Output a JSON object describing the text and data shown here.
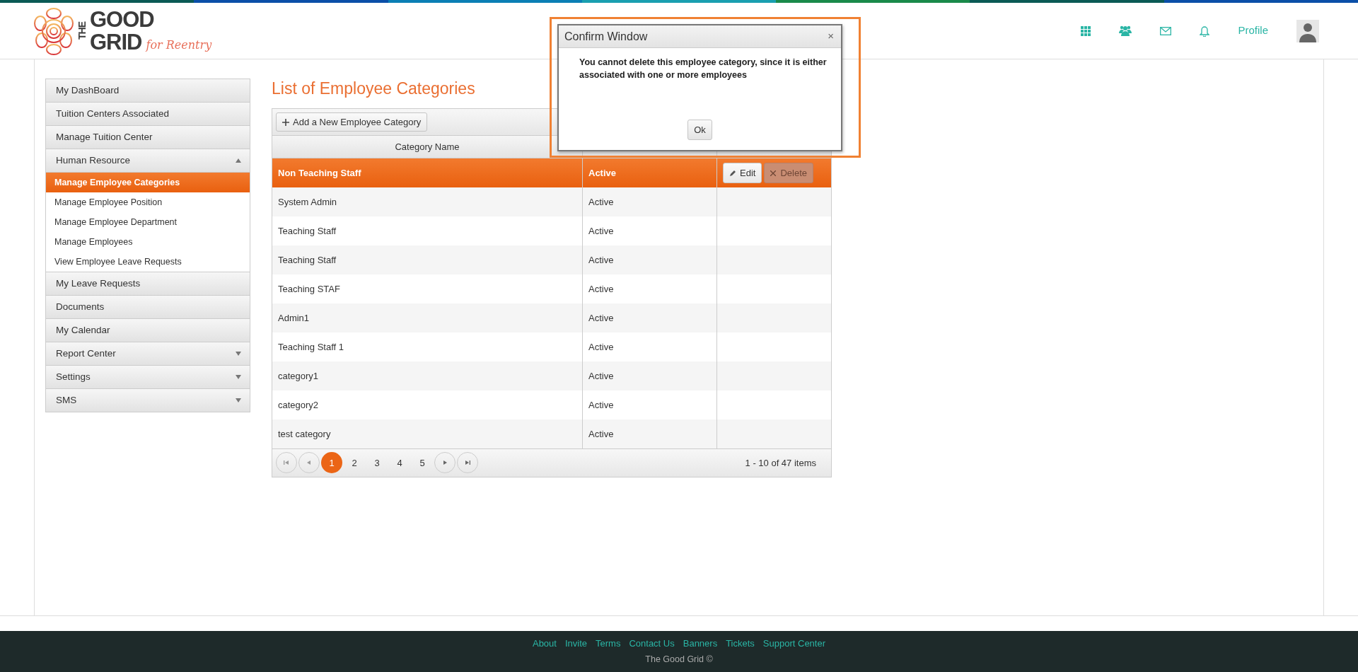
{
  "logo": {
    "prefix": "THE",
    "line1": "GOOD",
    "line2": "GRID",
    "tagline": "for Reentry"
  },
  "top_nav": {
    "profile": "Profile"
  },
  "sidebar": {
    "items": [
      {
        "label": "My DashBoard",
        "kind": "link"
      },
      {
        "label": "Tuition Centers Associated",
        "kind": "link"
      },
      {
        "label": "Manage Tuition Center",
        "kind": "link"
      },
      {
        "label": "Human Resource",
        "kind": "group",
        "expanded": true,
        "children": [
          {
            "label": "Manage Employee Categories",
            "selected": true
          },
          {
            "label": "Manage Employee Position",
            "selected": false
          },
          {
            "label": "Manage Employee Department",
            "selected": false
          },
          {
            "label": "Manage Employees",
            "selected": false
          },
          {
            "label": "View Employee Leave Requests",
            "selected": false
          }
        ]
      },
      {
        "label": "My Leave Requests",
        "kind": "link"
      },
      {
        "label": "Documents",
        "kind": "link"
      },
      {
        "label": "My Calendar",
        "kind": "link"
      },
      {
        "label": "Report Center",
        "kind": "group",
        "expanded": false
      },
      {
        "label": "Settings",
        "kind": "group",
        "expanded": false
      },
      {
        "label": "SMS",
        "kind": "group",
        "expanded": false
      }
    ]
  },
  "page_title": "List of Employee Categories",
  "toolbar": {
    "add_button": "Add a New Employee Category"
  },
  "table": {
    "columns": [
      "Category Name"
    ],
    "rows": [
      {
        "name": "Non Teaching Staff",
        "status": "Active",
        "selected": true,
        "buttons": [
          {
            "label": "Edit",
            "kind": "edit",
            "hovered": false
          },
          {
            "label": "Delete",
            "kind": "delete",
            "hovered": true
          }
        ]
      },
      {
        "name": "System Admin",
        "status": "Active",
        "selected": false
      },
      {
        "name": "Teaching Staff",
        "status": "Active",
        "selected": false
      },
      {
        "name": "Teaching Staff",
        "status": "Active",
        "selected": false
      },
      {
        "name": "Teaching STAF",
        "status": "Active",
        "selected": false
      },
      {
        "name": "Admin1",
        "status": "Active",
        "selected": false
      },
      {
        "name": "Teaching Staff 1",
        "status": "Active",
        "selected": false
      },
      {
        "name": "category1",
        "status": "Active",
        "selected": false
      },
      {
        "name": "category2",
        "status": "Active",
        "selected": false
      },
      {
        "name": "test category",
        "status": "Active",
        "selected": false
      }
    ]
  },
  "pager": {
    "pages": [
      {
        "label": "1",
        "selected": true
      },
      {
        "label": "2",
        "selected": false
      },
      {
        "label": "3",
        "selected": false
      },
      {
        "label": "4",
        "selected": false
      },
      {
        "label": "5",
        "selected": false
      }
    ],
    "info": "1 - 10 of 47 items"
  },
  "dialog": {
    "title": "Confirm Window",
    "close": "×",
    "message": "You cannot delete this employee category, since it is either associated with one or more employees",
    "ok_button": "Ok"
  },
  "footer": {
    "links": [
      "About",
      "Invite",
      "Terms",
      "Contact Us",
      "Banners",
      "Tickets",
      "Support Center"
    ],
    "copyright": "The Good Grid ©"
  }
}
